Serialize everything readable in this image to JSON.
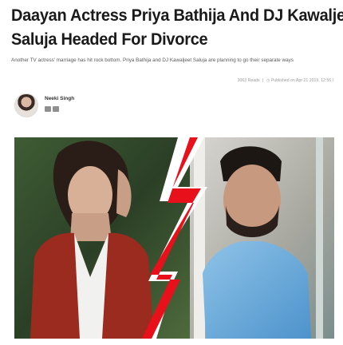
{
  "article": {
    "headline_line1": "Daayan Actress Priya Bathija And DJ Kawaljeet",
    "headline_line2": "Saluja Headed For Divorce",
    "summary": "Another TV actress' marriage has hit rock bottom. Priya Bathija and DJ Kawaljeet Saluja are planning to go their separate ways",
    "reads": "3063 Reads",
    "published": "Published on Apr 21 2019, 12:56 I"
  },
  "author": {
    "name": "Neeki Singh"
  },
  "icons": {
    "social_1": "facebook-icon",
    "social_2": "twitter-icon"
  },
  "colors": {
    "lightning": "#e8101b",
    "headline": "#1a1a1a"
  }
}
